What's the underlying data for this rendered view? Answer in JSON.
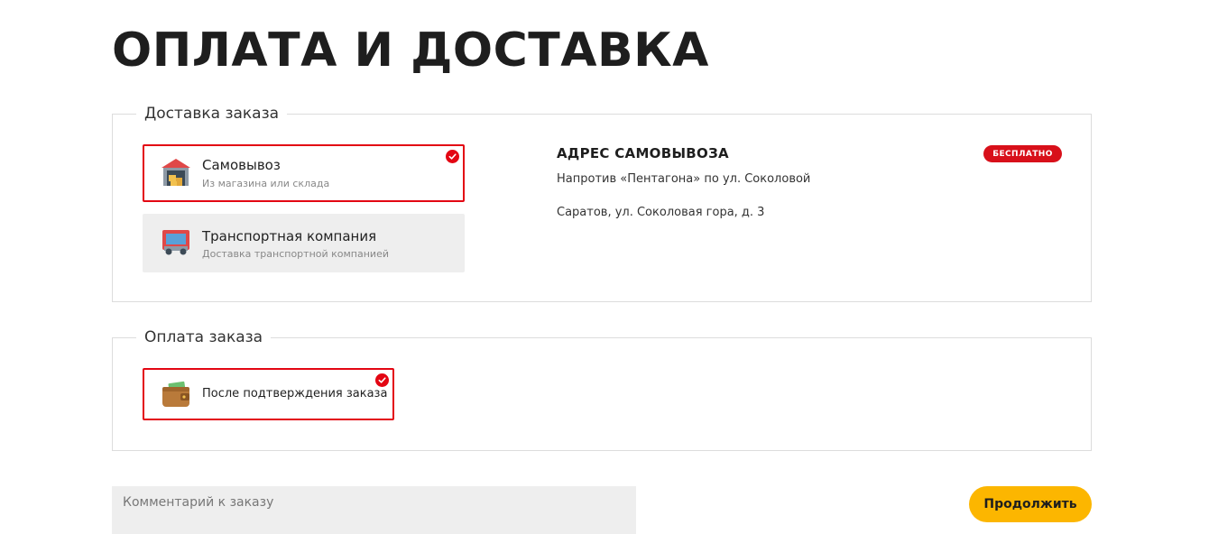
{
  "page": {
    "title": "ОПЛАТА И ДОСТАВКА"
  },
  "delivery": {
    "legend": "Доставка заказа",
    "options": [
      {
        "title": "Самовывоз",
        "subtitle": "Из магазина или склада",
        "icon": "warehouse-icon",
        "selected": true
      },
      {
        "title": "Транспортная компания",
        "subtitle": "Доставка транспортной компанией",
        "icon": "truck-icon",
        "selected": false
      }
    ],
    "address": {
      "title": "АДРЕС САМОВЫВОЗА",
      "badge": "БЕСПЛАТНО",
      "line1": "Напротив «Пентагона» по ул. Соколовой",
      "line2": "Саратов, ул. Соколовая гора, д. 3"
    }
  },
  "payment": {
    "legend": "Оплата заказа",
    "options": [
      {
        "title": "После подтверждения заказа",
        "icon": "wallet-icon",
        "selected": true
      }
    ]
  },
  "comment": {
    "placeholder": "Комментарий к заказу",
    "value": ""
  },
  "actions": {
    "continue_label": "Продолжить"
  },
  "colors": {
    "accent_red": "#e30613",
    "badge_red": "#d8101a",
    "button_yellow": "#fcb600",
    "option_bg": "#eeeeee",
    "border": "#dcdcdc"
  }
}
